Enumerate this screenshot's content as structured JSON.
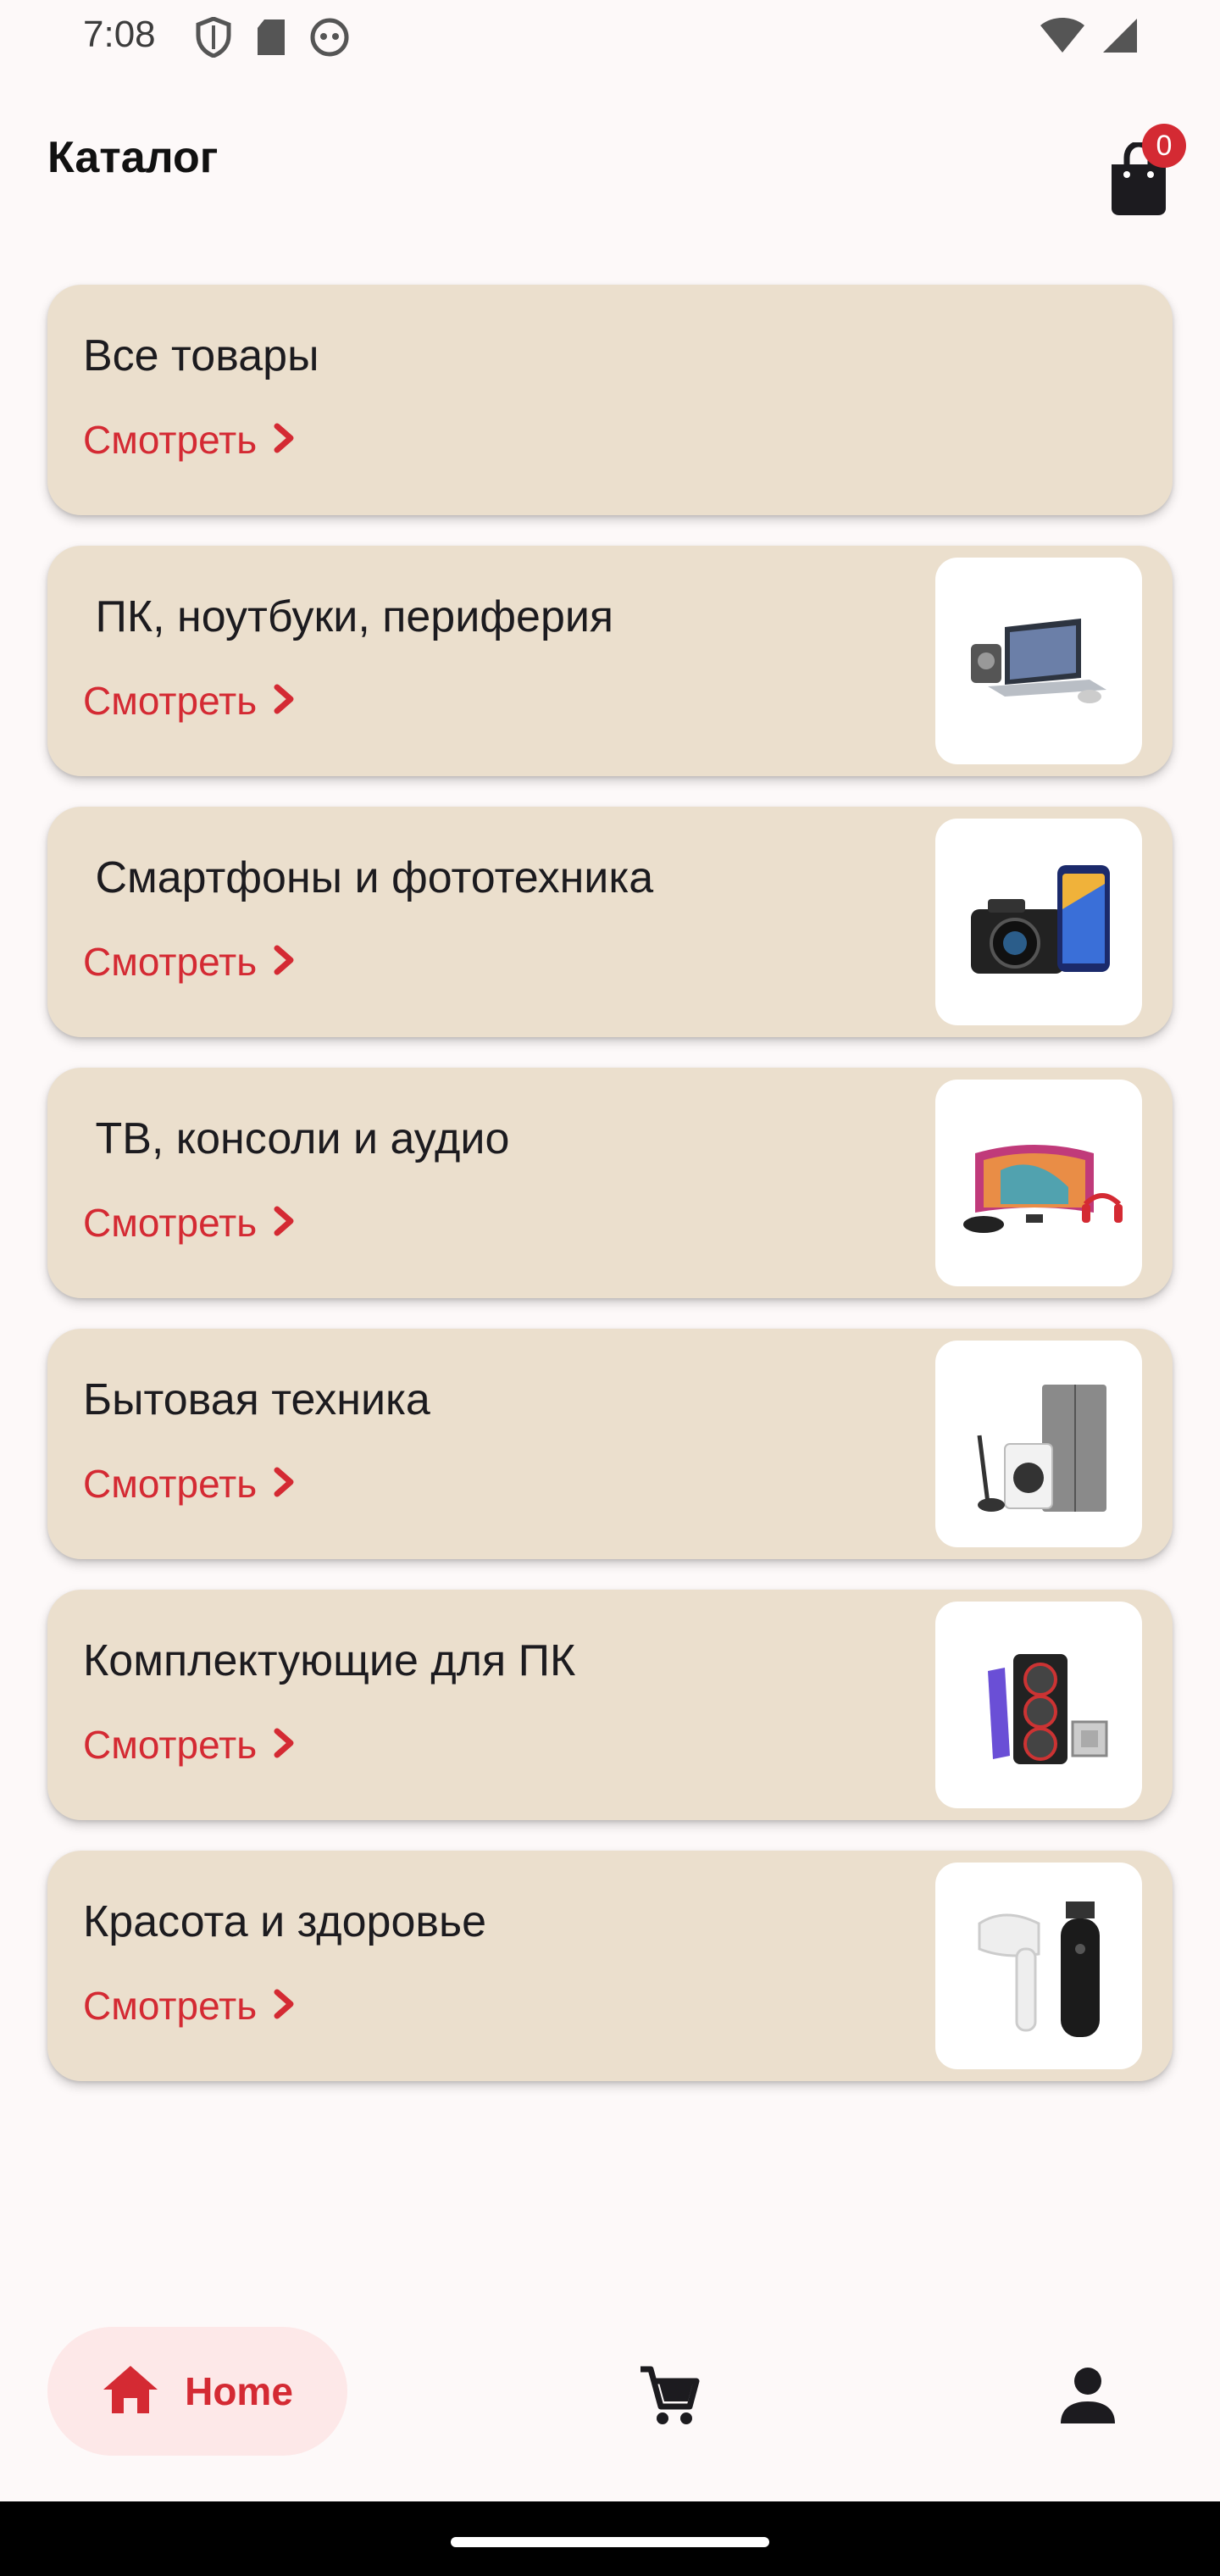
{
  "status_bar": {
    "time": "7:08",
    "icons_left": [
      "shield-icon",
      "sd-card-icon",
      "robot-icon"
    ],
    "icons_right": [
      "wifi-icon",
      "cell-signal-icon"
    ]
  },
  "app_bar": {
    "title": "Каталог",
    "cart_count": "0"
  },
  "catalog": {
    "link_label": "Смотреть",
    "items": [
      {
        "title": "Все товары",
        "image": "none"
      },
      {
        "title": " ПК, ноутбуки, периферия",
        "image": "laptop-peripherals-image"
      },
      {
        "title": " Смартфоны и фототехника",
        "image": "camera-smartphone-image"
      },
      {
        "title": " ТВ, консоли и аудио",
        "image": "tv-console-audio-image"
      },
      {
        "title": "Бытовая техника",
        "image": "appliances-image"
      },
      {
        "title": "Комплектующие для ПК",
        "image": "pc-components-image"
      },
      {
        "title": "Красота и здоровье",
        "image": "beauty-health-image"
      }
    ]
  },
  "bottom_nav": {
    "home_label": "Home",
    "accent_color": "#d42a33",
    "card_color": "#ebdfcd"
  }
}
